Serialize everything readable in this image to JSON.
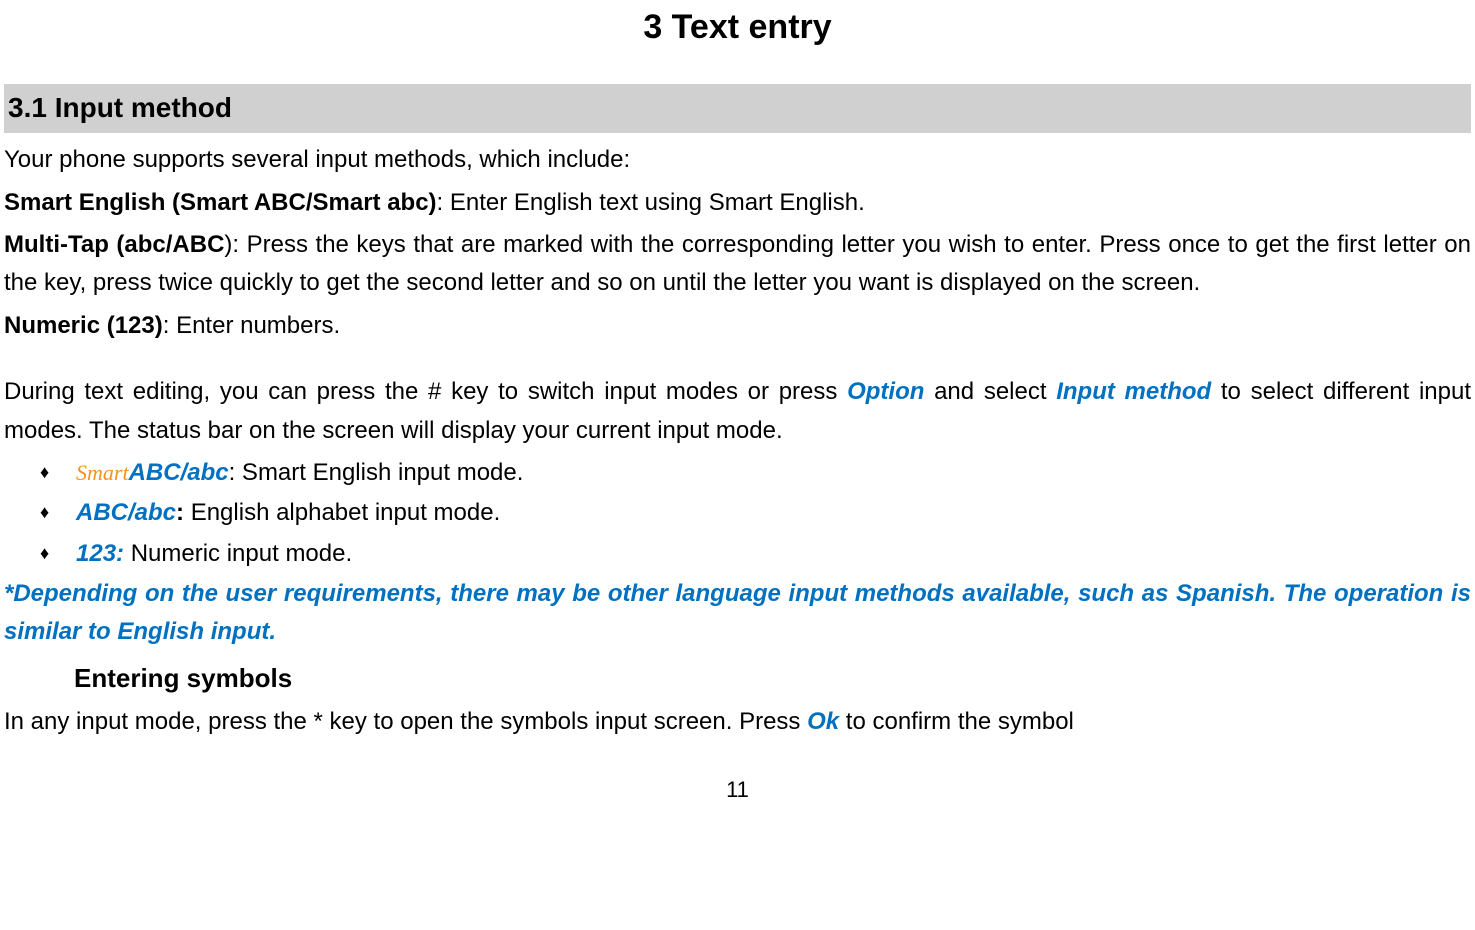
{
  "chapter": {
    "title": "3  Text entry"
  },
  "section": {
    "heading": "3.1  Input method",
    "intro": "Your phone supports several input methods, which include:",
    "smart_label": "Smart English (Smart ABC/Smart abc)",
    "smart_desc": ": Enter English text using Smart English.",
    "multitap_label": "Multi-Tap (abc/ABC",
    "multitap_desc": "): Press the keys that are marked with the corresponding letter you wish to enter. Press once to get the first letter on the key, press twice quickly to get the second letter and so on until the letter you want is displayed on the screen.",
    "numeric_label": "Numeric (123)",
    "numeric_desc": ": Enter numbers.",
    "editing_pre": "During text editing, you can press the # key to switch input modes or press ",
    "option_hl": "Option",
    "editing_mid": " and select ",
    "inputmethod_hl": "Input method",
    "editing_post": " to select different input modes. The status bar on the screen will display your current input mode."
  },
  "bullets": {
    "smart_icon_text": "Smart",
    "b1_hl": "ABC/abc",
    "b1_text": ": Smart English input mode.",
    "b2_hl": "ABC/abc",
    "b2_colon": ": ",
    "b2_text": "English alphabet input mode.",
    "b3_hl": "123:",
    "b3_text": " Numeric input mode."
  },
  "note": "*Depending on the user requirements, there may be other language input methods available, such as Spanish. The operation is similar to English input.",
  "symbols": {
    "heading": "Entering symbols",
    "text_pre": "In any input mode, press the * key to open the symbols input screen. Press ",
    "ok_hl": "Ok",
    "text_post": " to confirm the symbol"
  },
  "page_number": "11"
}
